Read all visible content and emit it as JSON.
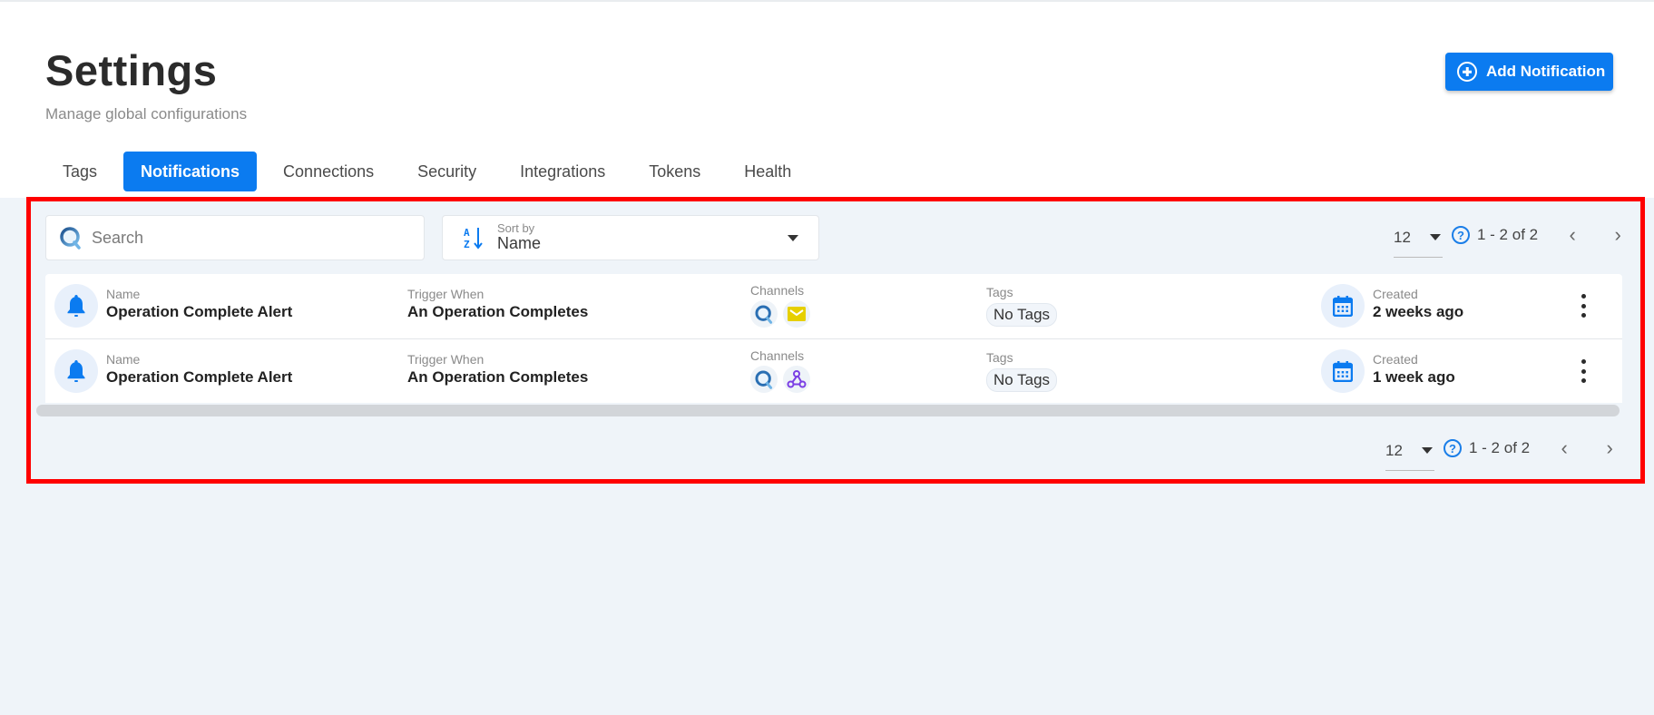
{
  "header": {
    "title": "Settings",
    "subtitle": "Manage global configurations",
    "add_button_label": "Add Notification",
    "add_button_icon": "plus-circle-icon"
  },
  "tabs": [
    {
      "label": "Tags",
      "active": false
    },
    {
      "label": "Notifications",
      "active": true
    },
    {
      "label": "Connections",
      "active": false
    },
    {
      "label": "Security",
      "active": false
    },
    {
      "label": "Integrations",
      "active": false
    },
    {
      "label": "Tokens",
      "active": false
    },
    {
      "label": "Health",
      "active": false
    }
  ],
  "toolbar": {
    "search_placeholder": "Search",
    "search_value": "",
    "sort_label": "Sort by",
    "sort_value": "Name"
  },
  "pagination": {
    "per_page": "12",
    "range": "1 - 2 of 2",
    "help_glyph": "?",
    "prev_glyph": "‹",
    "next_glyph": "›"
  },
  "columns": {
    "name": "Name",
    "trigger": "Trigger When",
    "channels": "Channels",
    "tags": "Tags",
    "created": "Created"
  },
  "rows": [
    {
      "name": "Operation Complete Alert",
      "trigger": "An Operation Completes",
      "channels": [
        "app-logo-icon",
        "email-icon"
      ],
      "tags": "No Tags",
      "created": "2 weeks ago"
    },
    {
      "name": "Operation Complete Alert",
      "trigger": "An Operation Completes",
      "channels": [
        "app-logo-icon",
        "webhook-icon"
      ],
      "tags": "No Tags",
      "created": "1 week ago"
    }
  ],
  "colors": {
    "primary": "#0b7bf0",
    "highlight_border": "#ff0000",
    "page_background": "#eff4f9",
    "email_channel": "#e6cf00",
    "webhook_channel": "#7b3fe4"
  }
}
